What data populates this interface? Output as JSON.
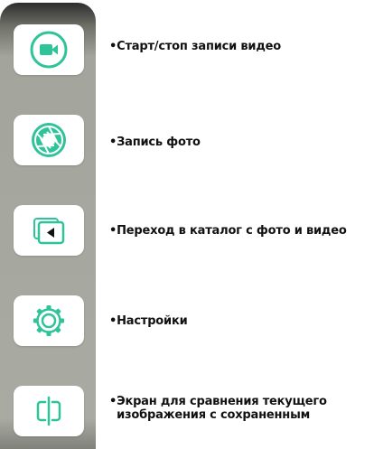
{
  "accent": "#2fc39a",
  "toolbar": {
    "buttons": [
      {
        "icon": "video-camera-icon",
        "label": "•Старт/стоп записи видео"
      },
      {
        "icon": "camera-shutter-icon",
        "label": "•Запись фото"
      },
      {
        "icon": "gallery-icon",
        "label": "•Переход в каталог с фото и видео"
      },
      {
        "icon": "gear-icon",
        "label": "•Настройки"
      },
      {
        "icon": "compare-split-icon",
        "bullet": "•",
        "label": "Экран для сравнения текущего\nизображения с сохраненным"
      }
    ]
  }
}
